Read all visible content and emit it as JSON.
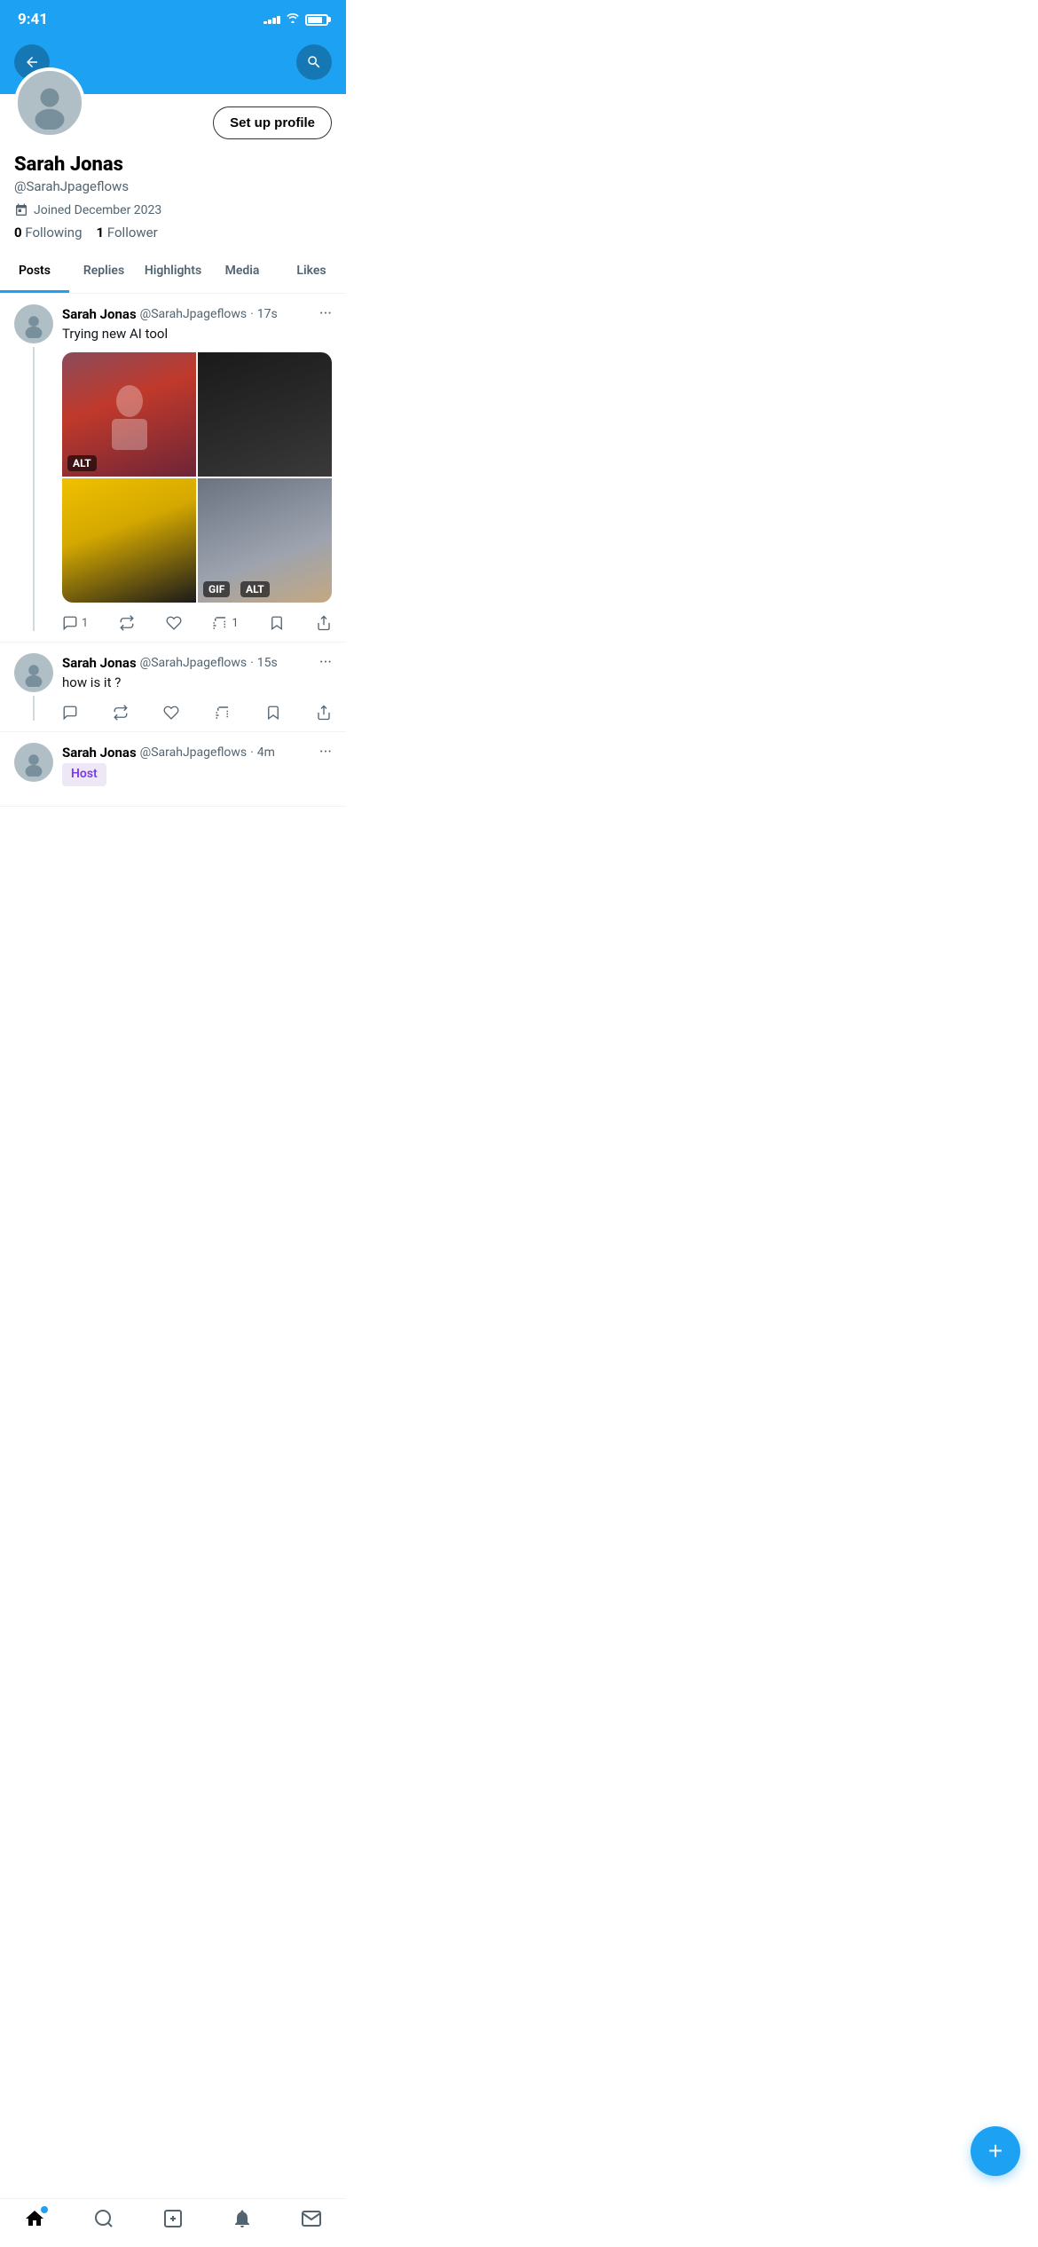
{
  "statusBar": {
    "time": "9:41",
    "signalBars": [
      3,
      5,
      7,
      9,
      11
    ],
    "batteryLevel": 80
  },
  "header": {
    "backButton": "←",
    "searchButton": "🔍"
  },
  "profile": {
    "name": "Sarah Jonas",
    "handle": "@SarahJpageflows",
    "joinedLabel": "Joined December 2023",
    "following": "0",
    "followingLabel": "Following",
    "followers": "1",
    "followersLabel": "Follower",
    "setupProfileLabel": "Set up profile"
  },
  "tabs": [
    {
      "id": "posts",
      "label": "Posts",
      "active": true
    },
    {
      "id": "replies",
      "label": "Replies",
      "active": false
    },
    {
      "id": "highlights",
      "label": "Highlights",
      "active": false
    },
    {
      "id": "media",
      "label": "Media",
      "active": false
    },
    {
      "id": "likes",
      "label": "Likes",
      "active": false
    }
  ],
  "posts": [
    {
      "id": 1,
      "username": "Sarah Jonas",
      "handle": "@SarahJpageflows",
      "time": "17s",
      "text": "Trying new AI tool",
      "hasImages": true,
      "images": [
        {
          "label": "ALT",
          "style": "img-1"
        },
        {
          "label": "",
          "style": "img-2"
        },
        {
          "label": "",
          "style": "img-3"
        },
        {
          "gifLabel": "GIF",
          "altLabel": "ALT",
          "style": "img-4"
        }
      ],
      "actions": {
        "comments": "1",
        "retweets": "",
        "likes": "",
        "views": "1",
        "bookmarks": "",
        "share": ""
      }
    },
    {
      "id": 2,
      "username": "Sarah Jonas",
      "handle": "@SarahJpageflows",
      "time": "15s",
      "text": "how is it ?",
      "hasImages": false,
      "actions": {
        "comments": "",
        "retweets": "",
        "likes": "",
        "views": "",
        "bookmarks": "",
        "share": ""
      }
    },
    {
      "id": 3,
      "username": "Sarah Jonas",
      "handle": "@SarahJpageflows",
      "time": "4m",
      "hostBadge": "Host",
      "hasImages": false
    }
  ],
  "fab": {
    "icon": "+"
  },
  "bottomNav": [
    {
      "id": "home",
      "icon": "home",
      "active": true,
      "hasDot": true
    },
    {
      "id": "search",
      "icon": "search",
      "active": false
    },
    {
      "id": "compose",
      "icon": "compose",
      "active": false
    },
    {
      "id": "notifications",
      "icon": "bell",
      "active": false
    },
    {
      "id": "messages",
      "icon": "mail",
      "active": false
    }
  ]
}
